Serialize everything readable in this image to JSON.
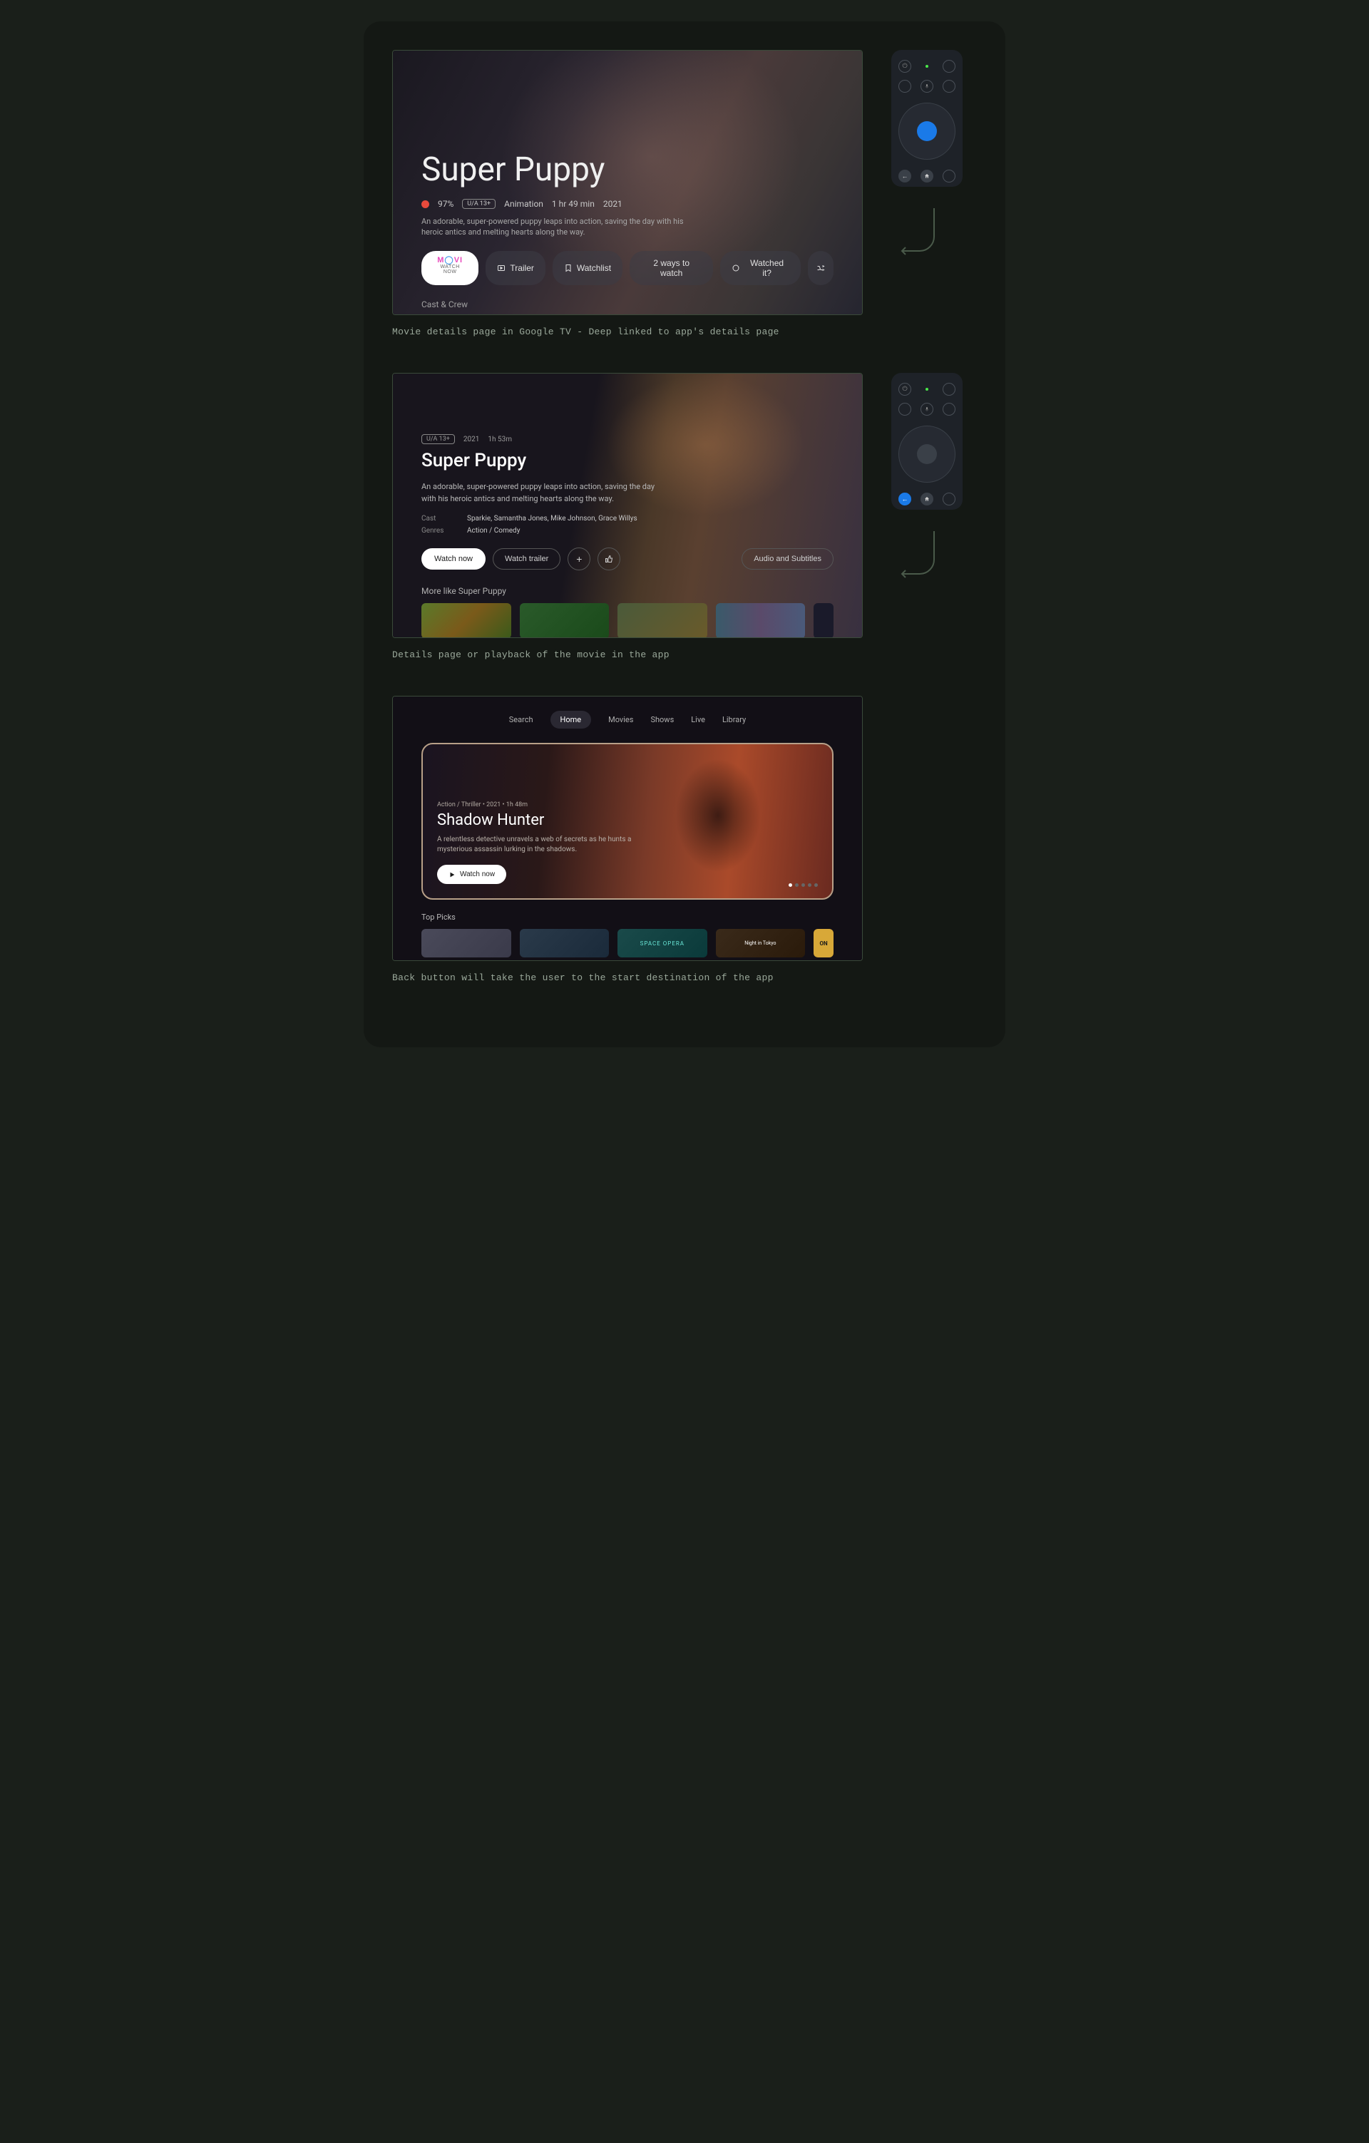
{
  "screen1": {
    "title": "Super Puppy",
    "score": "97%",
    "rating": "U/A 13+",
    "genre": "Animation",
    "duration": "1 hr 49 min",
    "year": "2021",
    "description": "An adorable, super-powered puppy leaps into action, saving the day with his heroic antics and melting hearts along the way.",
    "watch_now_logo_sub": "WATCH NOW",
    "trailer": "Trailer",
    "watchlist": "Watchlist",
    "ways": "2 ways to watch",
    "watched": "Watched it?",
    "cast_crew": "Cast & Crew"
  },
  "caption1": "Movie details page in Google TV - Deep linked to app's details page",
  "screen2": {
    "rating": "U/A 13+",
    "year": "2021",
    "duration": "1h 53m",
    "title": "Super Puppy",
    "description": "An adorable, super-powered puppy leaps into action, saving the day with his heroic antics and melting hearts along the way.",
    "cast_label": "Cast",
    "cast_value": "Sparkie, Samantha Jones, Mike Johnson, Grace Willys",
    "genres_label": "Genres",
    "genres_value": "Action / Comedy",
    "watch_now": "Watch now",
    "watch_trailer": "Watch trailer",
    "audio_subs": "Audio and Subtitles",
    "more_like": "More like Super Puppy"
  },
  "caption2": "Details page or playback of the movie in the app",
  "screen3": {
    "nav": {
      "search": "Search",
      "home": "Home",
      "movies": "Movies",
      "shows": "Shows",
      "live": "Live",
      "library": "Library"
    },
    "hero": {
      "meta": "Action / Thriller • 2021 • 1h 48m",
      "title": "Shadow Hunter",
      "description": "A relentless detective unravels a web of secrets as he hunts a mysterious assassin lurking in the shadows.",
      "watch_now": "Watch now"
    },
    "top_picks": "Top Picks",
    "pick3_label": "SPACE OPERA",
    "pick4_label": "Night in Tokyo",
    "pick5_label": "ON"
  },
  "caption3": "Back button will take the user to the start destination of the app"
}
